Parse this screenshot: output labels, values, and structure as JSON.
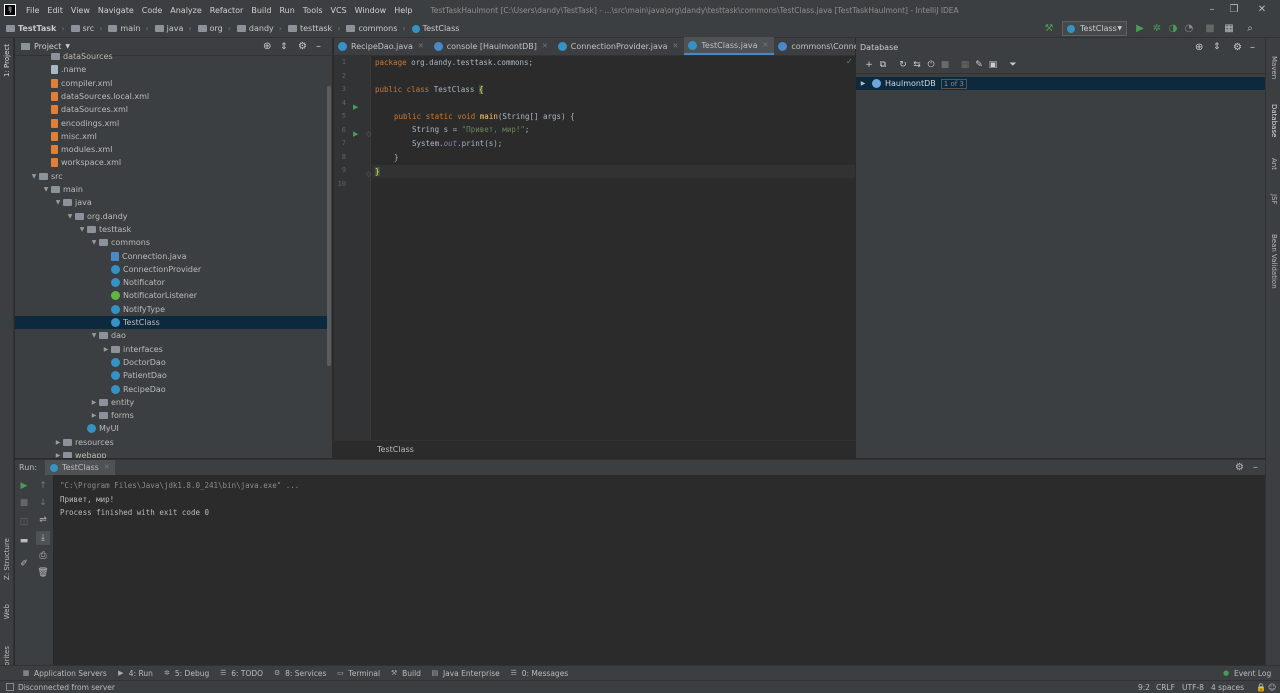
{
  "menu": {
    "items": [
      "File",
      "Edit",
      "View",
      "Navigate",
      "Code",
      "Analyze",
      "Refactor",
      "Build",
      "Run",
      "Tools",
      "VCS",
      "Window",
      "Help"
    ],
    "window_title": "TestTaskHaulmont [C:\\Users\\dandy\\TestTask] - ...\\src\\main\\java\\org\\dandy\\testtask\\commons\\TestClass.java [TestTaskHaulmont] - IntelliJ IDEA"
  },
  "breadcrumb": [
    "TestTask",
    "src",
    "main",
    "java",
    "org",
    "dandy",
    "testtask",
    "commons",
    "TestClass"
  ],
  "run_config": "TestClass",
  "left_strip": {
    "project": "1: Project",
    "structure": "Z: Structure",
    "web": "Web",
    "favorites": "2: Favorites"
  },
  "right_strip": {
    "maven": "Maven",
    "database": "Database",
    "ant": "Ant",
    "jsf": "JSF",
    "bean_validation": "Bean Validation"
  },
  "project": {
    "title": "Project",
    "tree": [
      {
        "label": "dataSources",
        "icon": "folder",
        "level": 2,
        "arrow": ""
      },
      {
        "label": ".name",
        "icon": "file",
        "level": 2,
        "arrow": ""
      },
      {
        "label": "compiler.xml",
        "icon": "xml",
        "level": 2,
        "arrow": ""
      },
      {
        "label": "dataSources.local.xml",
        "icon": "xml",
        "level": 2,
        "arrow": ""
      },
      {
        "label": "dataSources.xml",
        "icon": "xml",
        "level": 2,
        "arrow": ""
      },
      {
        "label": "encodings.xml",
        "icon": "xml",
        "level": 2,
        "arrow": ""
      },
      {
        "label": "misc.xml",
        "icon": "xml",
        "level": 2,
        "arrow": ""
      },
      {
        "label": "modules.xml",
        "icon": "xml",
        "level": 2,
        "arrow": ""
      },
      {
        "label": "workspace.xml",
        "icon": "xml",
        "level": 2,
        "arrow": ""
      },
      {
        "label": "src",
        "icon": "folder",
        "level": 1,
        "arrow": "open"
      },
      {
        "label": "main",
        "icon": "folder",
        "level": 2,
        "arrow": "open"
      },
      {
        "label": "java",
        "icon": "folder",
        "level": 3,
        "arrow": "open"
      },
      {
        "label": "org.dandy",
        "icon": "folder",
        "level": 4,
        "arrow": "open"
      },
      {
        "label": "testtask",
        "icon": "folder",
        "level": 5,
        "arrow": "open"
      },
      {
        "label": "commons",
        "icon": "folder",
        "level": 6,
        "arrow": "open"
      },
      {
        "label": "Connection.java",
        "icon": "java",
        "level": 7,
        "arrow": ""
      },
      {
        "label": "ConnectionProvider",
        "icon": "class",
        "level": 7,
        "arrow": ""
      },
      {
        "label": "Notificator",
        "icon": "class",
        "level": 7,
        "arrow": ""
      },
      {
        "label": "NotificatorListener",
        "icon": "iface",
        "level": 7,
        "arrow": ""
      },
      {
        "label": "NotifyType",
        "icon": "enum",
        "level": 7,
        "arrow": ""
      },
      {
        "label": "TestClass",
        "icon": "class",
        "level": 7,
        "arrow": "",
        "selected": true
      },
      {
        "label": "dao",
        "icon": "folder",
        "level": 6,
        "arrow": "open"
      },
      {
        "label": "interfaces",
        "icon": "folder",
        "level": 7,
        "arrow": "closed"
      },
      {
        "label": "DoctorDao",
        "icon": "class",
        "level": 7,
        "arrow": ""
      },
      {
        "label": "PatientDao",
        "icon": "class",
        "level": 7,
        "arrow": ""
      },
      {
        "label": "RecipeDao",
        "icon": "class",
        "level": 7,
        "arrow": ""
      },
      {
        "label": "entity",
        "icon": "folder",
        "level": 6,
        "arrow": "closed"
      },
      {
        "label": "forms",
        "icon": "folder",
        "level": 6,
        "arrow": "closed"
      },
      {
        "label": "MyUI",
        "icon": "class",
        "level": 5,
        "arrow": ""
      },
      {
        "label": "resources",
        "icon": "folder",
        "level": 3,
        "arrow": "closed"
      },
      {
        "label": "webapp",
        "icon": "folder",
        "level": 3,
        "arrow": "closed"
      }
    ]
  },
  "editor": {
    "tabs": [
      {
        "label": "RecipeDao.java",
        "color": "#3592c4",
        "active": false
      },
      {
        "label": "console [HaulmontDB]",
        "color": "#4a88c7",
        "active": false
      },
      {
        "label": "ConnectionProvider.java",
        "color": "#3592c4",
        "active": false
      },
      {
        "label": "TestClass.java",
        "color": "#3592c4",
        "active": true
      },
      {
        "label": "commons\\Connection",
        "color": "#4a88c7",
        "active": false
      }
    ],
    "line_numbers": [
      "1",
      "2",
      "3",
      "4",
      "5",
      "6",
      "7",
      "8",
      "9",
      "10"
    ],
    "code": {
      "l1_kw": "package",
      "l1_rest": " org.dandy.testtask.commons;",
      "l3_kw": "public class",
      "l3_name": " TestClass ",
      "l3_brace": "{",
      "l5_kw": "public static void",
      "l5_fn": "main",
      "l5_rest": "(String[] args) {",
      "l6_a": "String s = ",
      "l6_str": "\"Привет, мир!\"",
      "l6_b": ";",
      "l7_a": "System.",
      "l7_fld": "out",
      "l7_b": ".print(s);",
      "l8": "}",
      "l9": "}"
    },
    "breadcrumb_footer": "TestClass"
  },
  "database": {
    "title": "Database",
    "source": "HaulmontDB",
    "count": "1 of 3"
  },
  "run": {
    "label": "Run:",
    "tab": "TestClass",
    "console": [
      "\"C:\\Program Files\\Java\\jdk1.8.0_241\\bin\\java.exe\" ...",
      "Привет, мир!",
      "",
      "Process finished with exit code 0"
    ]
  },
  "bottom_tabs": [
    {
      "label": "Application Servers",
      "icon": "▦"
    },
    {
      "label": "4: Run",
      "icon": "▶"
    },
    {
      "label": "5: Debug",
      "icon": "✲"
    },
    {
      "label": "6: TODO",
      "icon": "☰"
    },
    {
      "label": "8: Services",
      "icon": "⚙"
    },
    {
      "label": "Terminal",
      "icon": "▭"
    },
    {
      "label": "Build",
      "icon": "⚒"
    },
    {
      "label": "Java Enterprise",
      "icon": "▤"
    },
    {
      "label": "0: Messages",
      "icon": "☰"
    }
  ],
  "event_log": "Event Log",
  "status": {
    "message": "Disconnected from server",
    "position": "9:2",
    "line_sep": "CRLF",
    "encoding": "UTF-8",
    "indent": "4 spaces"
  },
  "colors": {
    "accent": "#4a88c7",
    "run_green": "#499c54",
    "selection": "#0d293e"
  }
}
